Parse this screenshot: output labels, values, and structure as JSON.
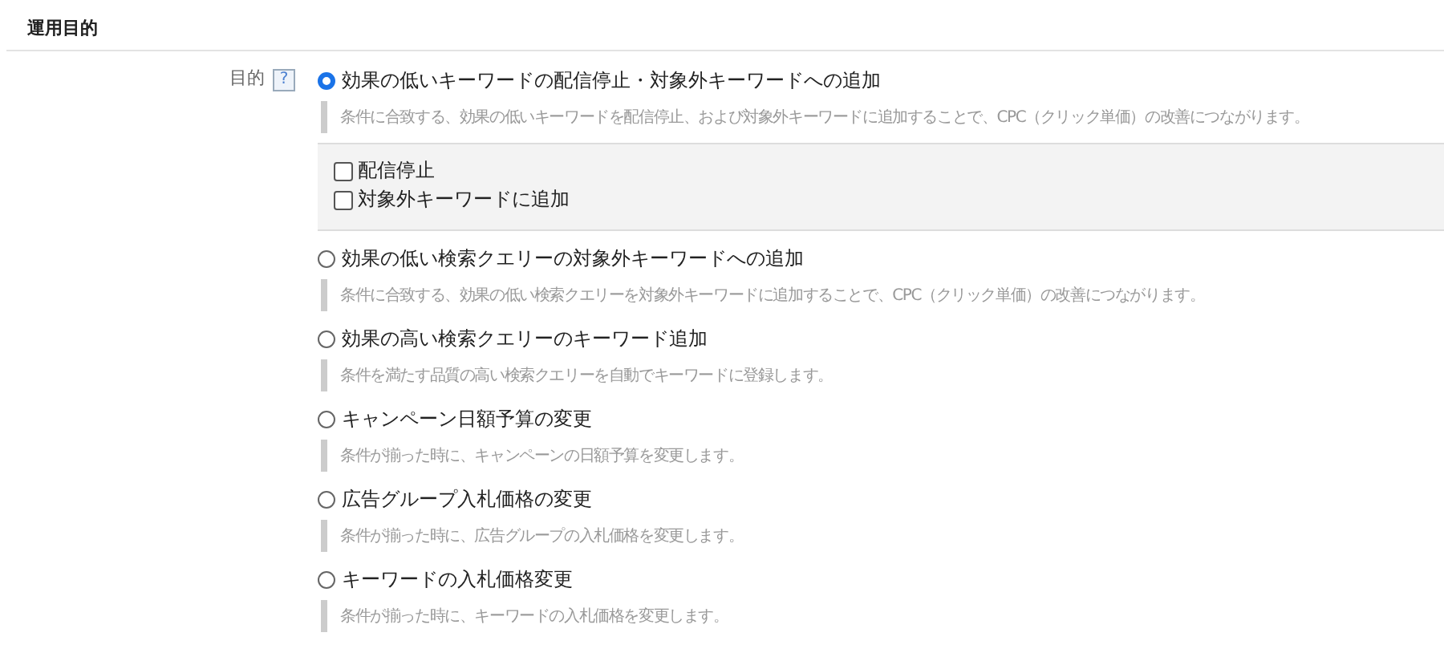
{
  "section_title": "運用目的",
  "field": {
    "label": "目的",
    "help": "?"
  },
  "options": [
    {
      "label": "効果の低いキーワードの配信停止・対象外キーワードへの追加",
      "selected": true,
      "description": "条件に合致する、効果の低いキーワードを配信停止、および対象外キーワードに追加することで、CPC（クリック単価）の改善につながります。",
      "checkboxes": [
        {
          "label": "配信停止",
          "checked": false
        },
        {
          "label": "対象外キーワードに追加",
          "checked": false
        }
      ]
    },
    {
      "label": "効果の低い検索クエリーの対象外キーワードへの追加",
      "selected": false,
      "description": "条件に合致する、効果の低い検索クエリーを対象外キーワードに追加することで、CPC（クリック単価）の改善につながります。"
    },
    {
      "label": "効果の高い検索クエリーのキーワード追加",
      "selected": false,
      "description": "条件を満たす品質の高い検索クエリーを自動でキーワードに登録します。"
    },
    {
      "label": "キャンペーン日額予算の変更",
      "selected": false,
      "description": "条件が揃った時に、キャンペーンの日額予算を変更します。"
    },
    {
      "label": "広告グループ入札価格の変更",
      "selected": false,
      "description": "条件が揃った時に、広告グループの入札価格を変更します。"
    },
    {
      "label": "キーワードの入札価格変更",
      "selected": false,
      "description": "条件が揃った時に、キーワードの入札価格を変更します。"
    }
  ]
}
